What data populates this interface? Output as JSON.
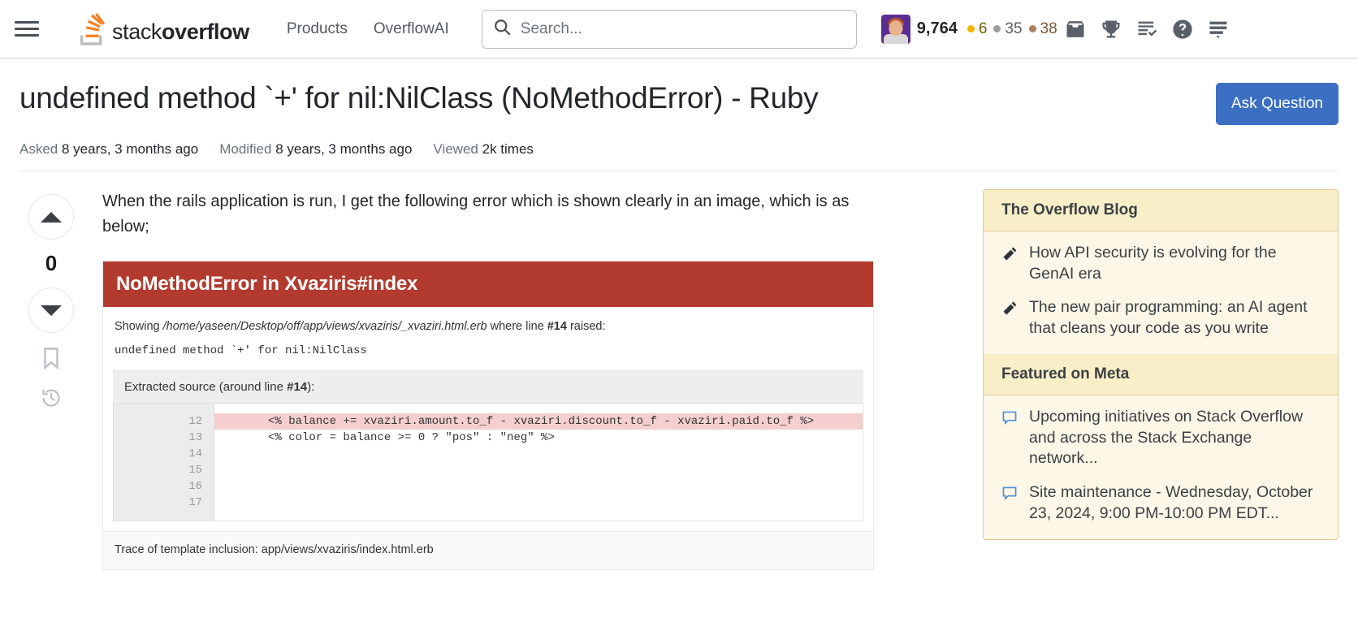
{
  "header": {
    "menu_icon": "hamburger-icon",
    "logo_text_light": "stack",
    "logo_text_bold": "overflow",
    "nav": [
      {
        "label": "Products"
      },
      {
        "label": "OverflowAI"
      }
    ],
    "search": {
      "placeholder": "Search...",
      "value": "",
      "icon": "search-icon"
    },
    "user": {
      "reputation": "9,764",
      "badges": {
        "gold": "6",
        "silver": "35",
        "bronze": "38"
      }
    },
    "icons": [
      {
        "name": "inbox-icon"
      },
      {
        "name": "trophy-icon"
      },
      {
        "name": "review-queue-icon"
      },
      {
        "name": "help-icon"
      },
      {
        "name": "site-switcher-icon"
      }
    ]
  },
  "question": {
    "title": "undefined method `+' for nil:NilClass (NoMethodError) - Ruby",
    "ask_button": "Ask Question",
    "meta": [
      {
        "label": "Asked",
        "value": "8 years, 3 months ago"
      },
      {
        "label": "Modified",
        "value": "8 years, 3 months ago"
      },
      {
        "label": "Viewed",
        "value": "2k times"
      }
    ],
    "vote_count": "0",
    "body_text": "When the rails application is run, I get the following error which is shown clearly in an image, which is as below;"
  },
  "error_image": {
    "heading": "NoMethodError in Xvaziris#index",
    "showing_prefix": "Showing ",
    "showing_path": "/home/yaseen/Desktop/off/app/views/xvaziris/_xvaziri.html.erb",
    "showing_mid": " where line ",
    "showing_line": "#14",
    "showing_suffix": " raised:",
    "message": "undefined method `+' for nil:NilClass",
    "extracted_prefix": "Extracted source (around line ",
    "extracted_line": "#14",
    "extracted_suffix": "):",
    "code": [
      {
        "num": "12",
        "text": "",
        "highlighted": false
      },
      {
        "num": "13",
        "text": "",
        "highlighted": false
      },
      {
        "num": "14",
        "text": "<% balance += xvaziri.amount.to_f - xvaziri.discount.to_f - xvaziri.paid.to_f %>",
        "highlighted": true
      },
      {
        "num": "15",
        "text": "",
        "highlighted": false
      },
      {
        "num": "16",
        "text": "<% color = balance >= 0 ? \"pos\" : \"neg\" %>",
        "highlighted": false
      },
      {
        "num": "17",
        "text": "",
        "highlighted": false
      }
    ],
    "trace": "Trace of template inclusion: app/views/xvaziris/index.html.erb"
  },
  "sidebar": {
    "blog": {
      "title": "The Overflow Blog",
      "items": [
        {
          "text": "How API security is evolving for the GenAI era",
          "icon": "pencil-icon"
        },
        {
          "text": "The new pair programming: an AI agent that cleans your code as you write",
          "icon": "pencil-icon"
        }
      ]
    },
    "meta": {
      "title": "Featured on Meta",
      "items": [
        {
          "text": "Upcoming initiatives on Stack Overflow and across the Stack Exchange network...",
          "icon": "speech-bubble-icon"
        },
        {
          "text": "Site maintenance - Wednesday, October 23, 2024, 9:00 PM-10:00 PM EDT...",
          "icon": "speech-bubble-icon"
        }
      ]
    }
  },
  "colors": {
    "brand_orange": "#f48024",
    "error_red": "#b33a2e",
    "ask_blue": "#3b6fc4",
    "highlight_pink": "#f5cfcf",
    "sidebar_cream": "#fdf7e7",
    "sidebar_header": "#f8eec7"
  }
}
